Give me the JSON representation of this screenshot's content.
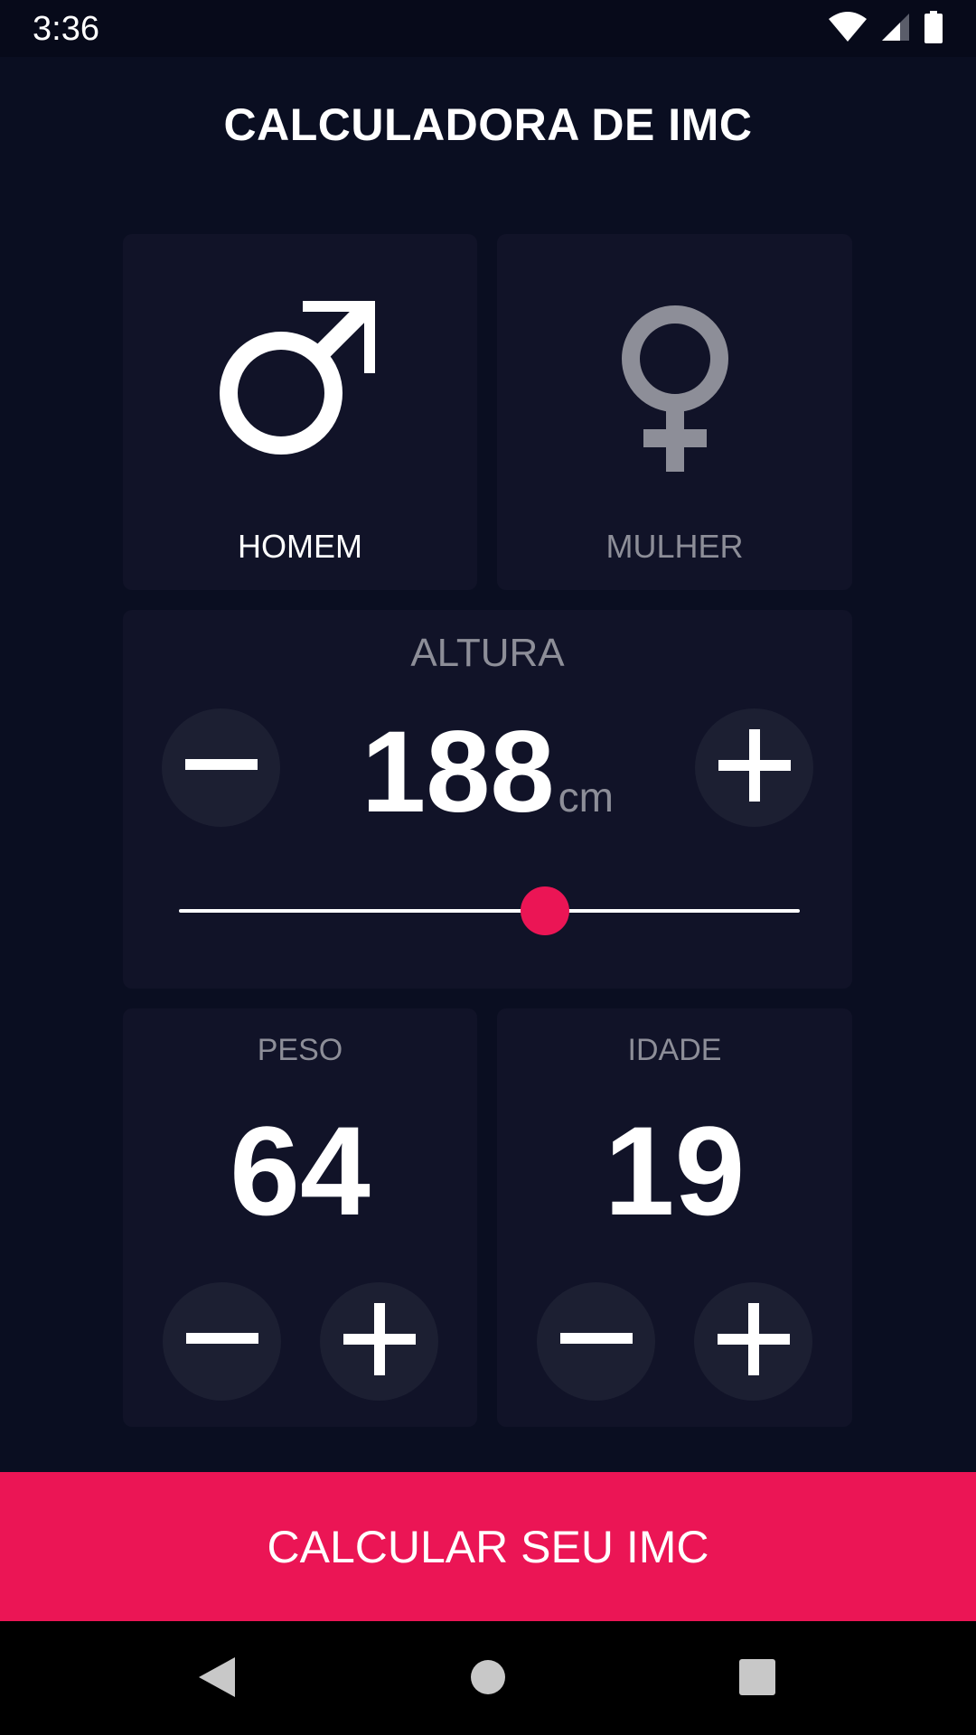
{
  "status_bar": {
    "time": "3:36",
    "icons": [
      "wifi-icon",
      "cell-signal-icon",
      "battery-icon"
    ]
  },
  "app": {
    "title": "CALCULADORA DE IMC"
  },
  "gender": {
    "male_label": "HOMEM",
    "female_label": "MULHER",
    "selected": "male"
  },
  "height": {
    "label": "ALTURA",
    "value": "188",
    "unit": "cm",
    "slider_fraction": 0.59
  },
  "weight": {
    "label": "PESO",
    "value": "64"
  },
  "age": {
    "label": "IDADE",
    "value": "19"
  },
  "calculate_button": {
    "label": "CALCULAR SEU IMC"
  },
  "colors": {
    "background": "#0a0e21",
    "card": "#111328",
    "round_button": "#1c1f32",
    "accent": "#eb1555",
    "inactive_text": "#8d8e98",
    "active_text": "#ffffff"
  },
  "nav_bar": {
    "icons": [
      "back-icon",
      "home-icon",
      "recents-icon"
    ]
  }
}
